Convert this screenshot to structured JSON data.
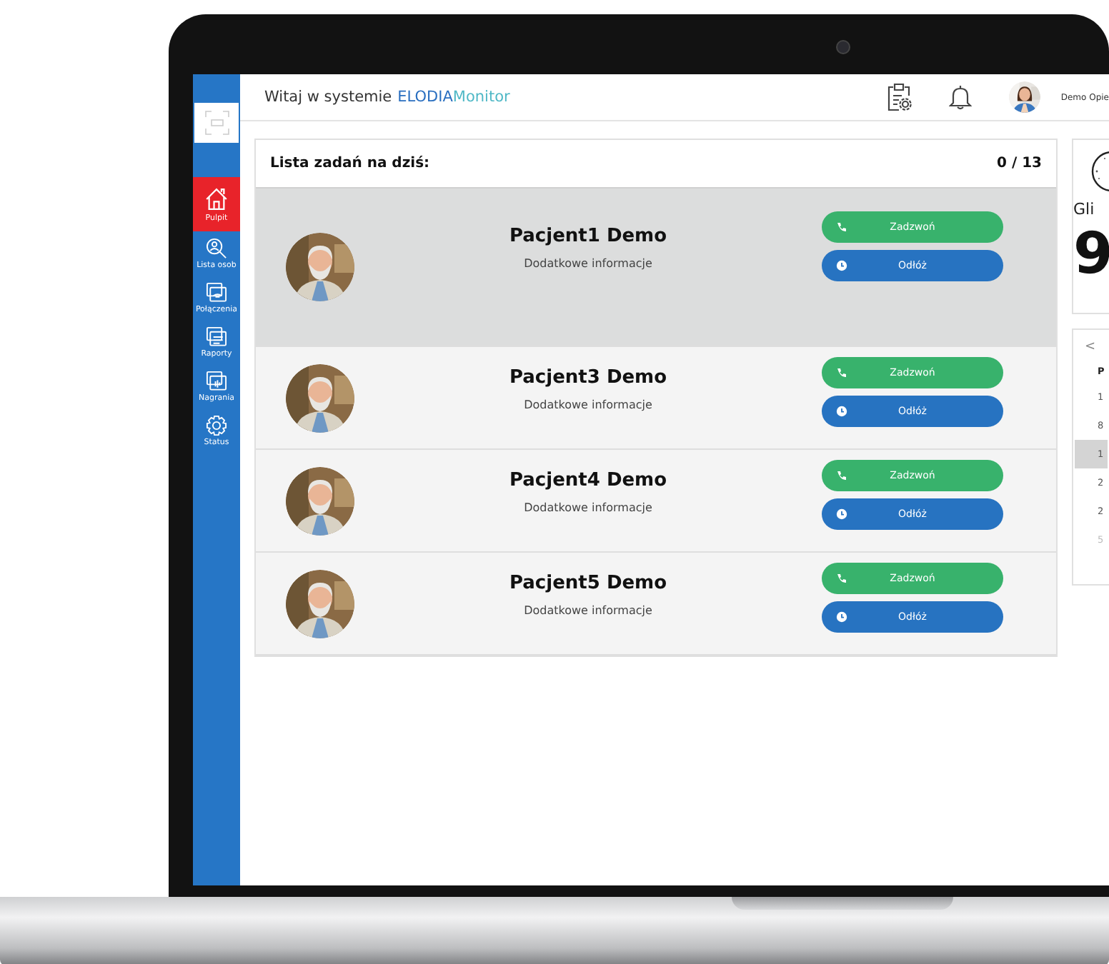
{
  "header": {
    "greeting": "Witaj w systemie",
    "brand": [
      "ELODIA",
      "Monitor"
    ],
    "user": "Demo Opie"
  },
  "sidebar": {
    "items": [
      {
        "label": "Pulpit",
        "selected": true
      },
      {
        "label": "Lista osob",
        "selected": false
      },
      {
        "label": "Połączenia",
        "selected": false
      },
      {
        "label": "Raporty",
        "selected": false
      },
      {
        "label": "Nagrania",
        "selected": false
      },
      {
        "label": "Status",
        "selected": false
      }
    ]
  },
  "tasks": {
    "title": "Lista zadań na dziś:",
    "count": "0 / 13",
    "items": [
      {
        "name": "Pacjent1 Demo",
        "info": "Dodatkowe informacje",
        "selected": true,
        "buttons": [
          {
            "label": "Zadzwoń",
            "kind": "call"
          },
          {
            "label": "Odłóż",
            "kind": "postpone"
          }
        ]
      },
      {
        "name": "Pacjent3 Demo",
        "info": "Dodatkowe informacje",
        "selected": false,
        "buttons": [
          {
            "label": "Zadzwoń",
            "kind": "call"
          },
          {
            "label": "Odłóż",
            "kind": "postpone"
          }
        ]
      },
      {
        "name": "Pacjent4 Demo",
        "info": "Dodatkowe informacje",
        "selected": false,
        "buttons": [
          {
            "label": "Zadzwoń",
            "kind": "call"
          },
          {
            "label": "Odłóż",
            "kind": "postpone"
          }
        ]
      },
      {
        "name": "Pacjent5 Demo",
        "info": "Dodatkowe informacje",
        "selected": false,
        "buttons": [
          {
            "label": "Zadzwoń",
            "kind": "call"
          },
          {
            "label": "Odłóż",
            "kind": "postpone"
          }
        ]
      }
    ]
  },
  "clock": {
    "city": "Gli",
    "time": "9"
  },
  "calendar": {
    "prev": "<",
    "weekday": "P",
    "days": [
      {
        "label": "1",
        "selected": false,
        "other_month": false
      },
      {
        "label": "8",
        "selected": false,
        "other_month": false
      },
      {
        "label": "1",
        "selected": true,
        "other_month": false
      },
      {
        "label": "2",
        "selected": false,
        "other_month": false
      },
      {
        "label": "2",
        "selected": false,
        "other_month": false
      },
      {
        "label": "5",
        "selected": false,
        "other_month": true
      }
    ]
  }
}
